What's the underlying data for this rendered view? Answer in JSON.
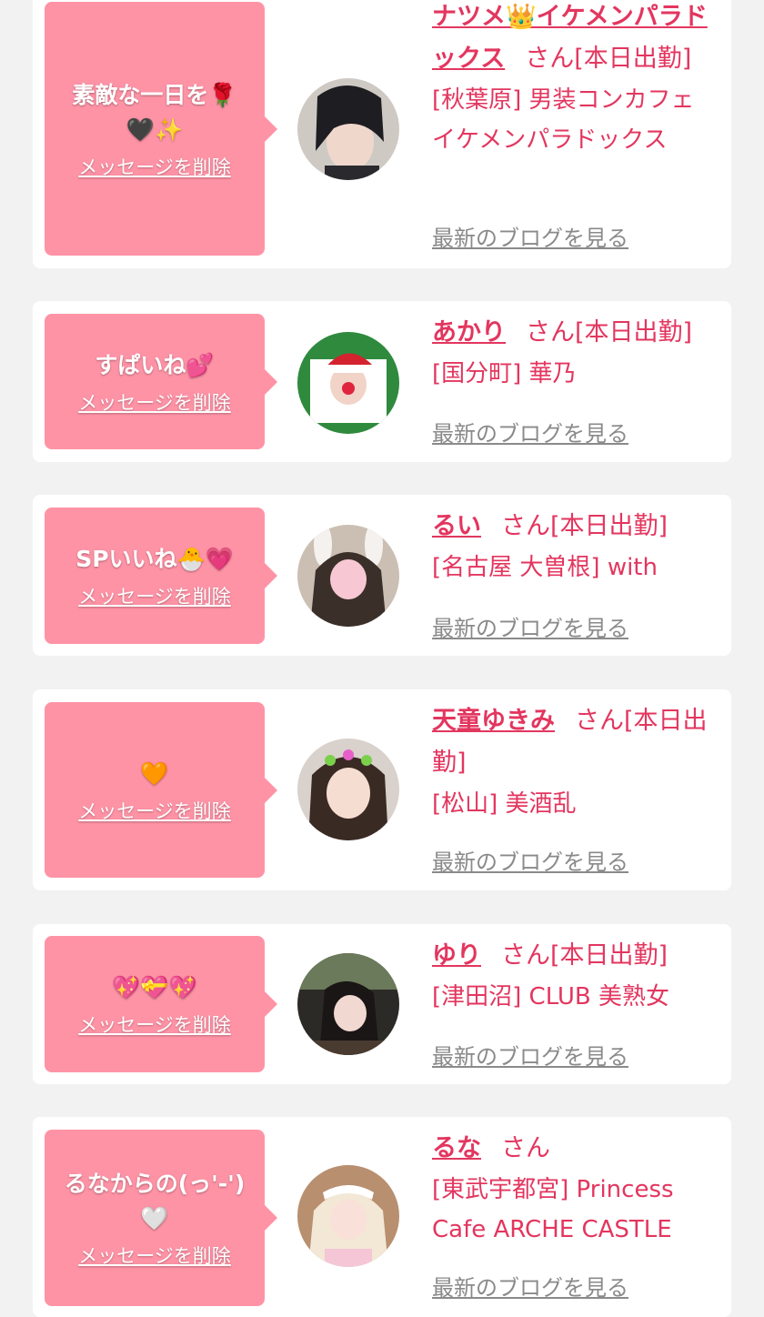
{
  "cards": [
    {
      "message": "素敵な一日を🌹🖤✨",
      "delete_label": "メッセージを削除",
      "avatar_icon": "cast-avatar-dark-hair",
      "name": "ナツメ👑イケメンパラドックス",
      "suffix": "さん[本日出勤]",
      "shop": "[秋葉原] 男装コンカフェ イケメンパラドックス",
      "blog_label": "最新のブログを見る"
    },
    {
      "message": "すぱいね💕",
      "delete_label": "メッセージを削除",
      "avatar_icon": "cast-avatar-santa-hat",
      "name": "あかり",
      "suffix": "さん[本日出勤]",
      "shop": "[国分町] 華乃",
      "blog_label": "最新のブログを見る"
    },
    {
      "message": "SPいいね🐣💗",
      "delete_label": "メッセージを削除",
      "avatar_icon": "cast-avatar-bunny-ears",
      "name": "るい",
      "suffix": "さん[本日出勤]",
      "shop": "[名古屋 大曽根] with",
      "blog_label": "最新のブログを見る"
    },
    {
      "message": "🧡",
      "delete_label": "メッセージを削除",
      "avatar_icon": "cast-avatar-flower-crown",
      "name": "天童ゆきみ",
      "suffix": "さん[本日出勤]",
      "shop": "[松山] 美酒乱",
      "blog_label": "最新のブログを見る"
    },
    {
      "message": "💖💝💖",
      "delete_label": "メッセージを削除",
      "avatar_icon": "cast-avatar-dark-room",
      "name": "ゆり",
      "suffix": "さん[本日出勤]",
      "shop": "[津田沼] CLUB 美熟女",
      "blog_label": "最新のブログを見る"
    },
    {
      "message": "るなからの(っ'-')🤍",
      "delete_label": "メッセージを削除",
      "avatar_icon": "cast-avatar-maid-headband",
      "name": "るな",
      "suffix": "さん",
      "shop": "[東武宇都宮] Princess Cafe ARCHE CASTLE",
      "blog_label": "最新のブログを見る"
    }
  ],
  "colors": {
    "page_background": "#f2f2f2",
    "bubble": "#ff93a6",
    "accent_text": "#e3365f",
    "link_gray": "#8a8a8a"
  }
}
